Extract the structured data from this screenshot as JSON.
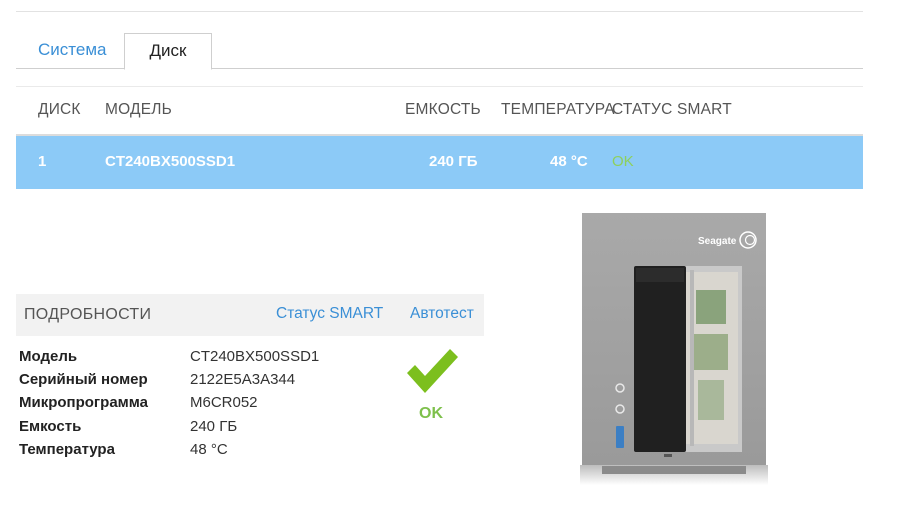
{
  "tabs": [
    {
      "label": "Система",
      "active": false
    },
    {
      "label": "Диск",
      "active": true
    }
  ],
  "table": {
    "headers": [
      "ДИСК",
      "МОДЕЛЬ",
      "ЕМКОСТЬ",
      "ТЕМПЕРАТУРА",
      "СТАТУС SMART"
    ],
    "rows": [
      {
        "disk": "1",
        "model": "CT240BX500SSD1",
        "capacity": "240 ГБ",
        "temperature": "48 °C",
        "smart": "OK"
      }
    ]
  },
  "details": {
    "title": "ПОДРОБНОСТИ",
    "smart_status_link": "Статус SMART",
    "selftest_link": "Автотест",
    "fields": [
      {
        "label": "Модель",
        "value": "CT240BX500SSD1"
      },
      {
        "label": "Серийный номер",
        "value": "2122E5A3A344"
      },
      {
        "label": "Микропрограмма",
        "value": "M6CR052"
      },
      {
        "label": "Емкость",
        "value": "240 ГБ"
      },
      {
        "label": "Температура",
        "value": "48 °C"
      }
    ],
    "status_text": "OK",
    "status_icon": "checkmark-icon"
  },
  "device": {
    "brand": "Seagate"
  },
  "colors": {
    "link": "#3a8fd6",
    "selected_row": "#8ccaf7",
    "ok_green": "#7ec04c"
  }
}
